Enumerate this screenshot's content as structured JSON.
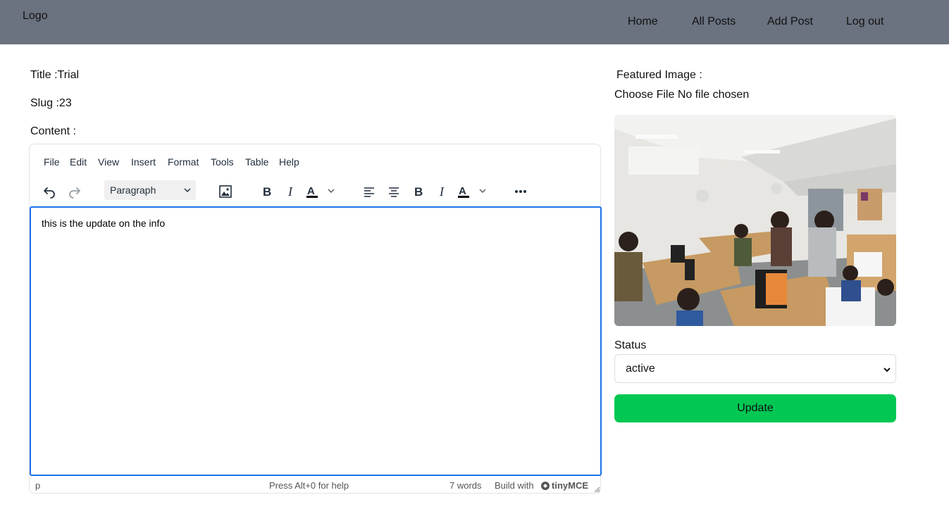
{
  "header": {
    "logo": "Logo",
    "nav": [
      "Home",
      "All Posts",
      "Add Post",
      "Log out"
    ]
  },
  "form": {
    "title_label": "Title :Trial",
    "slug_label": "Slug :23",
    "content_label": "Content :"
  },
  "editor": {
    "menu": [
      "File",
      "Edit",
      "View",
      "Insert",
      "Format",
      "Tools",
      "Table",
      "Help"
    ],
    "block_format": "Paragraph",
    "body_text": "this is the update on the info",
    "status_path": "p",
    "help_hint": "Press Alt+0 for help",
    "word_count": "7 words",
    "build_with": "Build with",
    "brand": "tinyMCE"
  },
  "sidebar": {
    "featured_label": "Featured Image :",
    "choose_file": "Choose File",
    "no_file": "No file chosen",
    "status_label": "Status",
    "status_value": "active",
    "update_label": "Update"
  },
  "colors": {
    "navbar": "#6b7280",
    "accent": "#1a73e8",
    "update_button": "#00c853"
  }
}
